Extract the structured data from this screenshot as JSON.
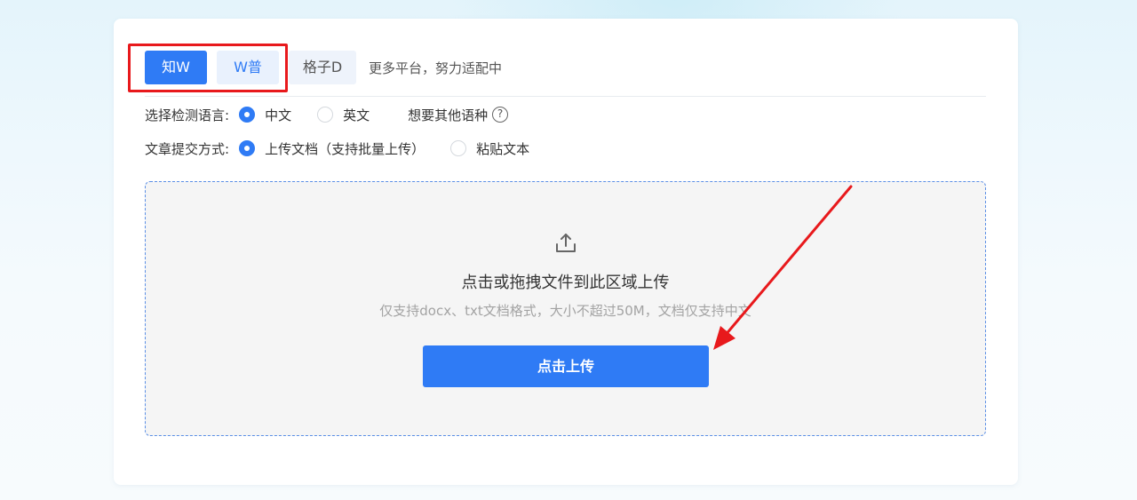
{
  "platform_tabs": [
    {
      "label": "知W",
      "state": "active"
    },
    {
      "label": "W普",
      "state": "inactive"
    },
    {
      "label": "格子D",
      "state": "inactive"
    }
  ],
  "more_platforms_text": "更多平台，努力适配中",
  "language": {
    "label": "选择检测语言:",
    "options": [
      {
        "label": "中文",
        "checked": true
      },
      {
        "label": "英文",
        "checked": false
      }
    ],
    "other_link": "想要其他语种",
    "help_icon": "question-circle-icon"
  },
  "submit_mode": {
    "label": "文章提交方式:",
    "options": [
      {
        "label": "上传文档（支持批量上传）",
        "checked": true
      },
      {
        "label": "粘贴文本",
        "checked": false
      }
    ]
  },
  "upload": {
    "icon": "upload-icon",
    "title": "点击或拖拽文件到此区域上传",
    "hint": "仅支持docx、txt文档格式，大小不超过50M，文档仅支持中文",
    "button_label": "点击上传"
  },
  "colors": {
    "accent": "#2f7bf5",
    "annotation_red": "#e8191c",
    "upload_border": "#5b8fe6"
  }
}
